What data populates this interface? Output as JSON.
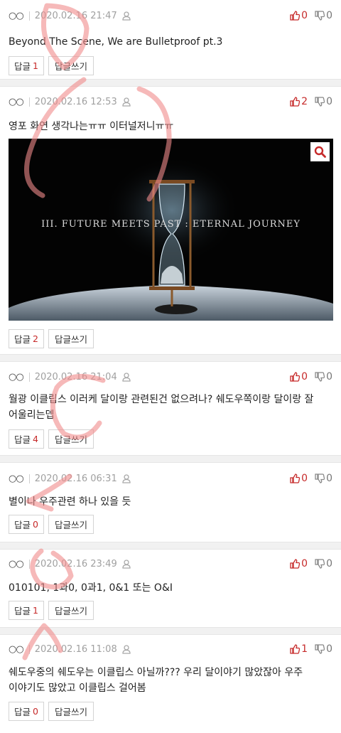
{
  "comments": [
    {
      "nick": "○○",
      "date": "2020.02.16 21:47",
      "up": "0",
      "down": "0",
      "text": "Beyond The Scene, We are Bulletproof pt.3",
      "reply_label": "답글",
      "reply_count": "1",
      "write_label": "답글쓰기"
    },
    {
      "nick": "○○",
      "date": "2020.02.16 12:53",
      "up": "2",
      "down": "0",
      "text": "영포 화연 생각나는ㅠㅠ 이터널저니ㅠㅠ",
      "image_caption": "III. FUTURE MEETS PAST : ETERNAL JOURNEY",
      "reply_label": "답글",
      "reply_count": "2",
      "write_label": "답글쓰기"
    },
    {
      "nick": "○○",
      "date": "2020.02.16 21:04",
      "up": "0",
      "down": "0",
      "text": "월광 이클립스 이러케 달이랑 관련된건 없으려나? 쉐도우쪽이랑 달이랑 잘 어울리는뎁",
      "reply_label": "답글",
      "reply_count": "4",
      "write_label": "답글쓰기"
    },
    {
      "nick": "○○",
      "date": "2020.02.16 06:31",
      "up": "0",
      "down": "0",
      "text": "별이나 우주관련 하나 있을 듯",
      "reply_label": "답글",
      "reply_count": "0",
      "write_label": "답글쓰기"
    },
    {
      "nick": "○○",
      "date": "2020.02.16 23:49",
      "up": "0",
      "down": "0",
      "text": "010101, 1과0, 0과1, 0&1 또는 O&I",
      "reply_label": "답글",
      "reply_count": "1",
      "write_label": "답글쓰기"
    },
    {
      "nick": "○○",
      "date": "2020.02.16 11:08",
      "up": "1",
      "down": "0",
      "text": "쉐도우중의 쉐도우는 이클립스 아닐까??? 우리 달이야기 많았잖아 우주 이야기도 많았고 이클립스 걸어봄",
      "reply_label": "답글",
      "reply_count": "0",
      "write_label": "답글쓰기"
    }
  ],
  "colors": {
    "accent": "#c62a2a",
    "annotation": "#f08a8a",
    "separator": "#f1f1f1"
  },
  "icons": {
    "user": "user-icon",
    "up": "thumbs-up-icon",
    "down": "thumbs-down-icon",
    "zoom": "search-icon"
  }
}
